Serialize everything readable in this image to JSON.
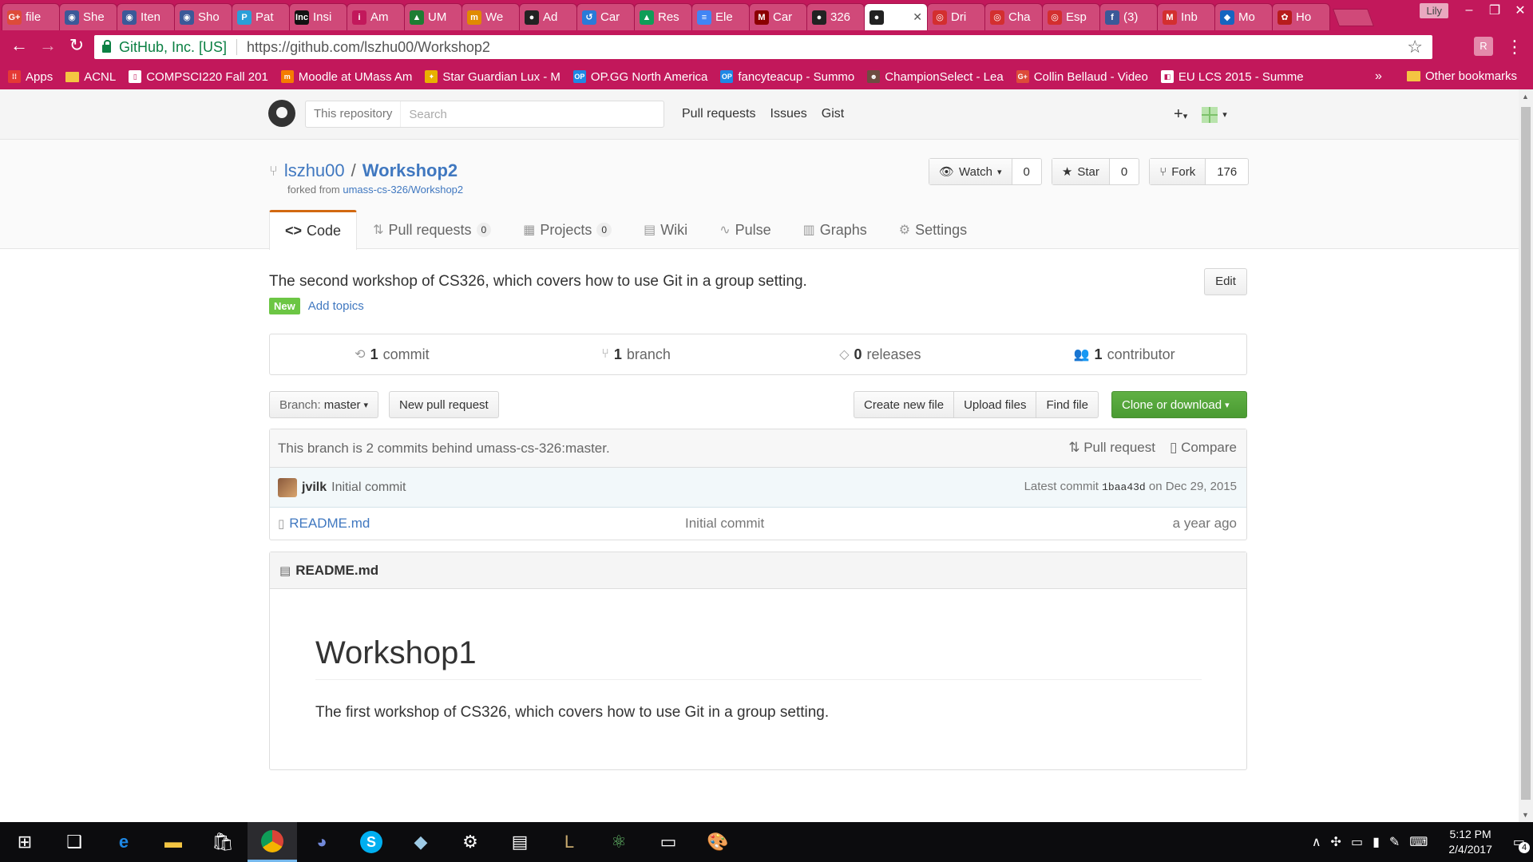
{
  "browser": {
    "tabs": [
      {
        "label": "file",
        "fav": "G+",
        "color": "#dd4b39"
      },
      {
        "label": "She",
        "fav": "◉",
        "color": "#3b5998"
      },
      {
        "label": "Iten",
        "fav": "◉",
        "color": "#3b5998"
      },
      {
        "label": "Sho",
        "fav": "◉",
        "color": "#3b5998"
      },
      {
        "label": "Pat",
        "fav": "P",
        "color": "#2a9fd8"
      },
      {
        "label": "Insi",
        "fav": "Inc",
        "color": "#111111"
      },
      {
        "label": "Am",
        "fav": "i",
        "color": "#c2185b"
      },
      {
        "label": "UM",
        "fav": "▲",
        "color": "#1e7d32"
      },
      {
        "label": "We",
        "fav": "m",
        "color": "#e08a00"
      },
      {
        "label": "Ad",
        "fav": "●",
        "color": "#222222"
      },
      {
        "label": "Car",
        "fav": "↺",
        "color": "#2a7ad8"
      },
      {
        "label": "Res",
        "fav": "▲",
        "color": "#0f9d58"
      },
      {
        "label": "Ele",
        "fav": "≡",
        "color": "#4285f4"
      },
      {
        "label": "Car",
        "fav": "M",
        "color": "#8b0000"
      },
      {
        "label": "326",
        "fav": "●",
        "color": "#222222"
      },
      {
        "label": "",
        "fav": "●",
        "color": "#222222"
      },
      {
        "label": "Dri",
        "fav": "◎",
        "color": "#d32f2f"
      },
      {
        "label": "Cha",
        "fav": "◎",
        "color": "#d32f2f"
      },
      {
        "label": "Esp",
        "fav": "◎",
        "color": "#d32f2f"
      },
      {
        "label": "(3)",
        "fav": "f",
        "color": "#3b5998"
      },
      {
        "label": "Inb",
        "fav": "M",
        "color": "#d32f2f"
      },
      {
        "label": "Mo",
        "fav": "◆",
        "color": "#1565c0"
      },
      {
        "label": "Ho",
        "fav": "✿",
        "color": "#b71c1c"
      }
    ],
    "user_button": "Lily",
    "ev_label": "GitHub, Inc. [US]",
    "url": "https://github.com/lszhu00/Workshop2",
    "bookmarks": [
      {
        "label": "Apps",
        "fav": "⁞⁞",
        "color": "#e53935"
      },
      {
        "label": "ACNL",
        "fav": "",
        "color": "#f4c542"
      },
      {
        "label": "COMPSCI220 Fall 201",
        "fav": "▯",
        "color": "#ffffff"
      },
      {
        "label": "Moodle at UMass Am",
        "fav": "m",
        "color": "#f57c00"
      },
      {
        "label": "Star Guardian Lux - M",
        "fav": "✦",
        "color": "#e8b100"
      },
      {
        "label": "OP.GG North America",
        "fav": "OP",
        "color": "#1e88e5"
      },
      {
        "label": "fancyteacup - Summo",
        "fav": "OP",
        "color": "#1e88e5"
      },
      {
        "label": "ChampionSelect - Lea",
        "fav": "☻",
        "color": "#6d4c41"
      },
      {
        "label": "Collin Bellaud - Video",
        "fav": "G+",
        "color": "#dd4b39"
      },
      {
        "label": "EU LCS 2015 - Summe",
        "fav": "◧",
        "color": "#ffffff"
      }
    ],
    "more": "»",
    "other_bookmarks": "Other bookmarks"
  },
  "github": {
    "search_scope": "This repository",
    "search_placeholder": "Search",
    "nav": [
      "Pull requests",
      "Issues",
      "Gist"
    ],
    "owner": "lszhu00",
    "repo": "Workshop2",
    "forked_prefix": "forked from",
    "forked_from": "umass-cs-326/Workshop2",
    "watch_label": "Watch",
    "watch_count": "0",
    "star_label": "Star",
    "star_count": "0",
    "fork_label": "Fork",
    "fork_count": "176",
    "tabs": {
      "code": "Code",
      "pulls": "Pull requests",
      "pulls_count": "0",
      "projects": "Projects",
      "projects_count": "0",
      "wiki": "Wiki",
      "pulse": "Pulse",
      "graphs": "Graphs",
      "settings": "Settings"
    },
    "description": "The second workshop of CS326, which covers how to use Git in a group setting.",
    "edit": "Edit",
    "new_badge": "New",
    "add_topics": "Add topics",
    "summary": {
      "commits_n": "1",
      "commits_label": "commit",
      "branches_n": "1",
      "branches_label": "branch",
      "releases_n": "0",
      "releases_label": "releases",
      "contributors_n": "1",
      "contributors_label": "contributor"
    },
    "branch_prefix": "Branch:",
    "branch_name": "master",
    "new_pr": "New pull request",
    "create_file": "Create new file",
    "upload_files": "Upload files",
    "find_file": "Find file",
    "clone": "Clone or download",
    "behind_msg": "This branch is 2 commits behind umass-cs-326:master.",
    "pull_request": "Pull request",
    "compare": "Compare",
    "commit_author": "jvilk",
    "commit_message": "Initial commit",
    "latest_prefix": "Latest commit",
    "latest_sha": "1baa43d",
    "latest_date": "on Dec 29, 2015",
    "files": [
      {
        "name": "README.md",
        "message": "Initial commit",
        "age": "a year ago"
      }
    ],
    "readme_title": "README.md",
    "readme_h1": "Workshop1",
    "readme_p": "The first workshop of CS326, which covers how to use Git in a group setting."
  },
  "taskbar": {
    "time": "5:12 PM",
    "date": "2/4/2017",
    "notif_count": "4"
  }
}
